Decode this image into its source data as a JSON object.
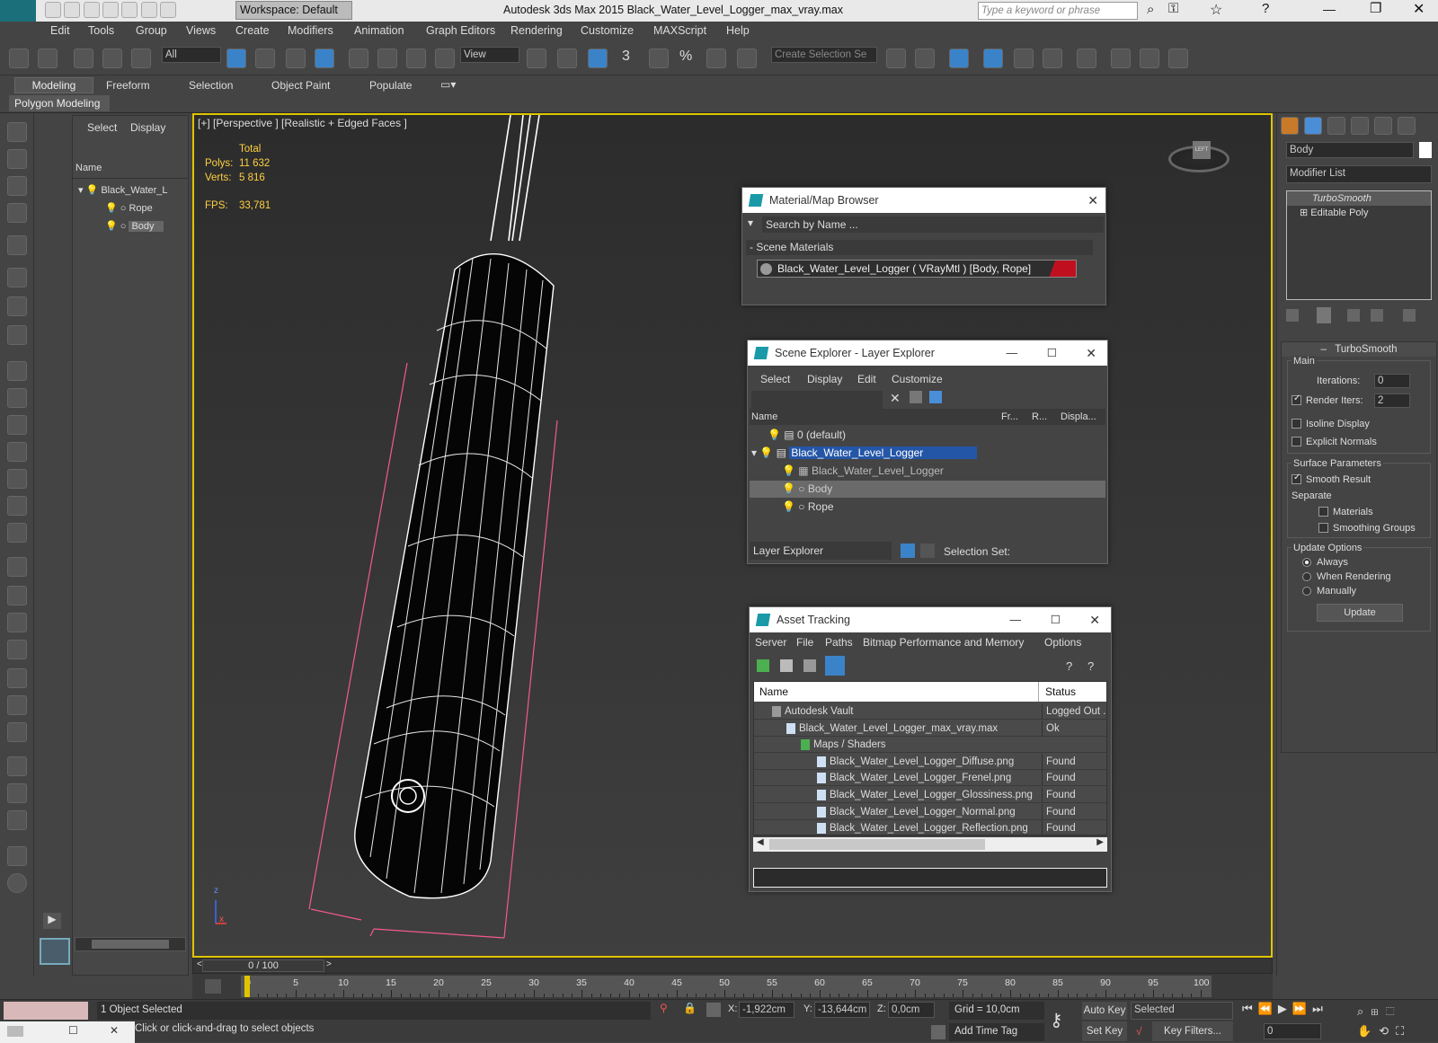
{
  "titlebar": {
    "workspace": "Workspace: Default",
    "title": "Autodesk 3ds Max  2015     Black_Water_Level_Logger_max_vray.max",
    "search_placeholder": "Type a keyword or phrase",
    "logo": "MAX"
  },
  "menu": [
    "Edit",
    "Tools",
    "Group",
    "Views",
    "Create",
    "Modifiers",
    "Animation",
    "Graph Editors",
    "Rendering",
    "Customize",
    "MAXScript",
    "Help"
  ],
  "toolbar": {
    "filter": "All",
    "view": "View",
    "selection_set": "Create Selection Se",
    "snap_3": "3",
    "snap_pct": "%"
  },
  "ribbon": {
    "tabs": [
      "Modeling",
      "Freeform",
      "Selection",
      "Object Paint",
      "Populate"
    ],
    "sub": "Polygon Modeling"
  },
  "scene_explorer_left": {
    "tabs": [
      "Select",
      "Display"
    ],
    "col": "Name",
    "items": [
      "Black_Water_L",
      "Rope",
      "Body"
    ]
  },
  "viewport": {
    "label": "[+] [Perspective ] [Realistic + Edged Faces ]",
    "stats": {
      "total": "Total",
      "polys_label": "Polys:",
      "polys": "11 632",
      "verts_label": "Verts:",
      "verts": "5 816",
      "fps_label": "FPS:",
      "fps": "33,781"
    },
    "axis_x": "x",
    "axis_z": "z",
    "cube_label": "LEFT"
  },
  "material_browser": {
    "title": "Material/Map Browser",
    "search": "Search by Name ...",
    "section": "- Scene Materials",
    "item": "Black_Water_Level_Logger ( VRayMtl ) [Body, Rope]"
  },
  "layer_explorer": {
    "title": "Scene Explorer - Layer Explorer",
    "menu": [
      "Select",
      "Display",
      "Edit",
      "Customize"
    ],
    "cols": [
      "Name",
      "Fr...",
      "R...",
      "Displa..."
    ],
    "rows": [
      "0 (default)",
      "Black_Water_Level_Logger",
      "Black_Water_Level_Logger",
      "Body",
      "Rope"
    ],
    "footer": "Layer Explorer",
    "selection_set": "Selection Set:"
  },
  "asset_tracking": {
    "title": "Asset Tracking",
    "menu": [
      "Server",
      "File",
      "Paths",
      "Bitmap Performance and Memory",
      "Options"
    ],
    "cols": [
      "Name",
      "Status"
    ],
    "rows": [
      {
        "name": "Autodesk Vault",
        "status": "Logged Out ."
      },
      {
        "name": "Black_Water_Level_Logger_max_vray.max",
        "status": "Ok"
      },
      {
        "name": "Maps / Shaders",
        "status": ""
      },
      {
        "name": "Black_Water_Level_Logger_Diffuse.png",
        "status": "Found"
      },
      {
        "name": "Black_Water_Level_Logger_Frenel.png",
        "status": "Found"
      },
      {
        "name": "Black_Water_Level_Logger_Glossiness.png",
        "status": "Found"
      },
      {
        "name": "Black_Water_Level_Logger_Normal.png",
        "status": "Found"
      },
      {
        "name": "Black_Water_Level_Logger_Reflection.png",
        "status": "Found"
      }
    ]
  },
  "command_panel": {
    "object_name": "Body",
    "modifier_list": "Modifier List",
    "stack": [
      "TurboSmooth",
      "Editable Poly"
    ],
    "rollout": "TurboSmooth",
    "main": "Main",
    "iterations_label": "Iterations:",
    "iterations": "0",
    "render_iters_label": "Render Iters:",
    "render_iters": "2",
    "isoline": "Isoline Display",
    "explicit": "Explicit Normals",
    "surface": "Surface Parameters",
    "smooth": "Smooth Result",
    "separate": "Separate",
    "materials": "Materials",
    "smoothing_groups": "Smoothing Groups",
    "update_options": "Update Options",
    "always": "Always",
    "when_rendering": "When Rendering",
    "manually": "Manually",
    "update": "Update"
  },
  "timeline": {
    "frame": "0 / 100",
    "ticks": [
      "0",
      "5",
      "10",
      "15",
      "20",
      "25",
      "30",
      "35",
      "40",
      "45",
      "50",
      "55",
      "60",
      "65",
      "70",
      "75",
      "80",
      "85",
      "90",
      "95",
      "100"
    ]
  },
  "status": {
    "selected": "1 Object Selected",
    "prompt": "Click or click-and-drag to select objects",
    "x_label": "X:",
    "x": "-1,922cm",
    "y_label": "Y:",
    "y": "-13,644cm",
    "z_label": "Z:",
    "z": "0,0cm",
    "grid": "Grid = 10,0cm",
    "auto_key": "Auto Key",
    "set_key": "Set Key",
    "selected_mode": "Selected",
    "key_filters": "Key Filters...",
    "add_time_tag": "Add Time Tag",
    "frame_field": "0"
  }
}
